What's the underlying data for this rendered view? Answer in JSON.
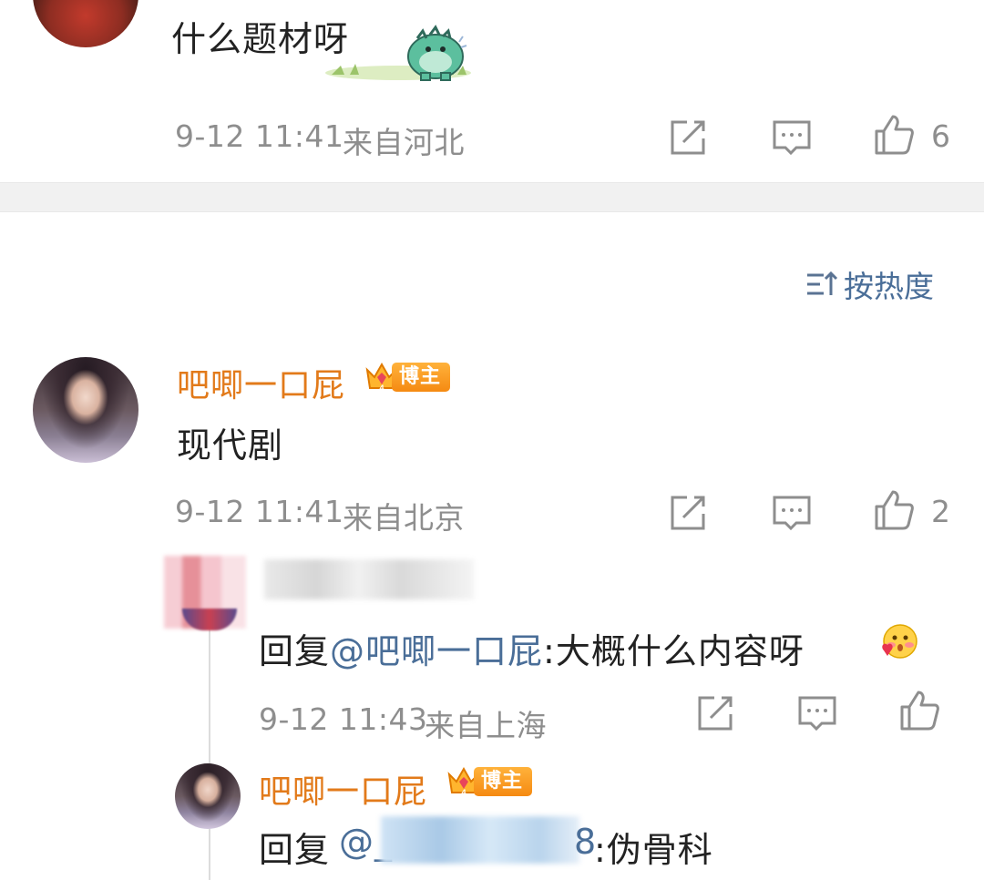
{
  "comment_top": {
    "text": "什么题材呀",
    "sticker_icon": "green-dinosaur-sticker",
    "time": "9-12 11:41",
    "location": "来自河北",
    "like_count": "6"
  },
  "sort": {
    "label": "按热度",
    "icon": "sort-icon"
  },
  "comment_main": {
    "username": "吧唧一口屁",
    "badge": "博主",
    "text": "现代剧",
    "time": "9-12 11:41",
    "location": "来自北京",
    "like_count": "2"
  },
  "reply_1": {
    "prefix": "回复",
    "mention": "@吧唧一口屁",
    "text": ":大概什么内容呀",
    "emoji_icon": "blushing-face-emoji",
    "time": "9-12 11:43",
    "location": "来自上海"
  },
  "reply_2": {
    "username": "吧唧一口屁",
    "badge": "博主",
    "prefix": "回复",
    "mention_start": "@_",
    "mention_end": "8",
    "text": ":伪骨科"
  },
  "colors": {
    "username": "#e27a1a",
    "mention": "#4a6e98",
    "meta": "#8e8e8e",
    "badge": "#f58a12"
  }
}
